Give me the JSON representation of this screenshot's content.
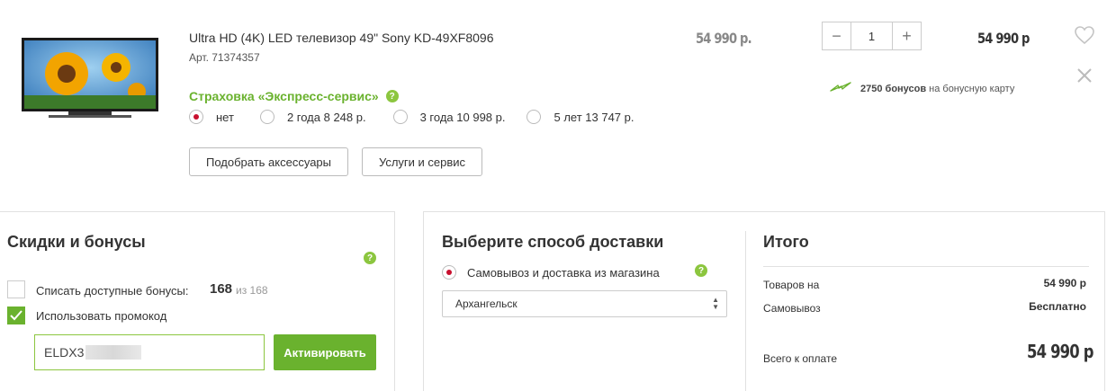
{
  "product": {
    "name": "Ultra HD (4K) LED телевизор 49\" Sony KD-49XF8096",
    "article": "Арт. 71374357",
    "unit_price": "54 990  р.",
    "total_price": "54 990 р",
    "quantity": "1",
    "minus": "−",
    "plus": "+",
    "bonus_amount": "2750 бонусов",
    "bonus_text": "на бонусную карту"
  },
  "insurance": {
    "title": "Страховка «Экспресс-сервис»",
    "help": "?",
    "options": [
      {
        "label": "нет",
        "selected": true
      },
      {
        "label": "2 года 8 248  р.",
        "selected": false
      },
      {
        "label": "3 года 10 998  р.",
        "selected": false
      },
      {
        "label": "5 лет 13 747  р.",
        "selected": false
      }
    ]
  },
  "actions": {
    "accessories": "Подобрать аксессуары",
    "services": "Услуги и сервис"
  },
  "discounts": {
    "title": "Скидки и бонусы",
    "help": "?",
    "use_bonuses_label": "Списать доступные бонусы:",
    "bonus_value": "168",
    "bonus_of": "из 168",
    "use_bonuses_checked": false,
    "promo_label": "Использовать промокод",
    "promo_checked": true,
    "promo_value": "ELDX3",
    "activate": "Активировать"
  },
  "delivery": {
    "title": "Выберите способ доставки",
    "option": "Самовывоз и доставка из магазина",
    "help": "?",
    "city": "Архангельск"
  },
  "summary": {
    "title": "Итого",
    "rows": [
      {
        "label": "Товаров на",
        "value": "54 990 р"
      },
      {
        "label": "Самовывоз",
        "value": "Бесплатно"
      }
    ],
    "total_label": "Всего к оплате",
    "total_value": "54 990 р"
  },
  "colors": {
    "accent_green": "#6ab22e",
    "radio_red": "#c8102e"
  }
}
